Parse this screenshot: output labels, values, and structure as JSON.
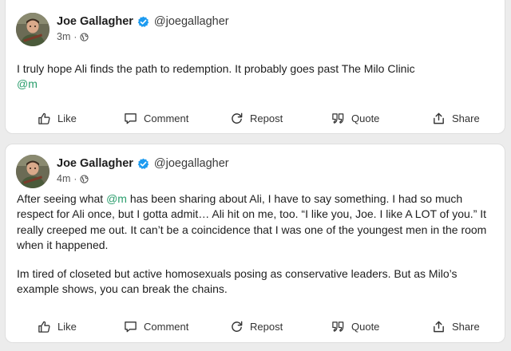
{
  "posts": [
    {
      "author": "Joe Gallagher",
      "handle": "@joegallagher",
      "time": "3m",
      "paragraphs": [
        [
          {
            "text": "I truly hope Ali finds the path to redemption. It probably goes past The Milo Clinic"
          },
          {
            "text": "\n"
          },
          {
            "text": "@m",
            "mention": true
          }
        ]
      ],
      "actions": [
        "Like",
        "Comment",
        "Repost",
        "Quote",
        "Share"
      ]
    },
    {
      "author": "Joe Gallagher",
      "handle": "@joegallagher",
      "time": "4m",
      "paragraphs": [
        [
          {
            "text": "After seeing what "
          },
          {
            "text": "@m",
            "mention": true
          },
          {
            "text": " has been sharing about Ali, I have to say something. I had so much respect for Ali once, but I gotta admit… Ali hit on me, too. “I like you, Joe. I like A LOT of you.” It really creeped me out. It can’t be a coincidence that I was one of the youngest men in the room when it happened."
          }
        ],
        [
          {
            "text": "Im tired of closeted but active homosexuals posing as conservative leaders. But as Milo’s example shows, you can break the chains."
          }
        ]
      ],
      "actions": [
        "Like",
        "Comment",
        "Repost",
        "Quote",
        "Share"
      ]
    }
  ],
  "colors": {
    "mention": "#2a9d6c",
    "verified": "#1d9bf0",
    "background": "#ececec"
  },
  "icons": {
    "verified": "verified-badge-icon",
    "audience": "globe-icon",
    "actions": [
      "thumbs-up-icon",
      "comment-icon",
      "repost-icon",
      "quote-icon",
      "share-icon"
    ]
  }
}
